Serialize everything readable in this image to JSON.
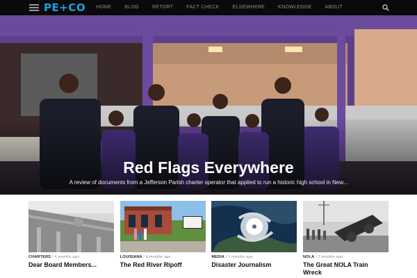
{
  "header": {
    "logo": "PE+CO",
    "nav": [
      "HOME",
      "BLOG",
      "RETORT",
      "FACT CHECK",
      "ELSEWHERE",
      "KNOWLEDGE",
      "ABOUT"
    ],
    "icons": {
      "menu": "hamburger-menu-icon",
      "search": "search-icon"
    },
    "colors": {
      "bar": "#0a0a0a",
      "logo": "#19a3e8"
    }
  },
  "hero": {
    "title": "Red Flags Everywhere",
    "subtitle": "A review of documents from a Jefferson Parish charter operator that applied to run a historic high school in New..."
  },
  "cards": [
    {
      "category": "CHARTERS",
      "age": "4 months ago",
      "title": "Dear Board Members..."
    },
    {
      "category": "LOUISIANA",
      "age": "6 months ago",
      "title": "The Red River Ripoff"
    },
    {
      "category": "MEDIA",
      "age": "7 months ago",
      "title": "Disaster Journalism"
    },
    {
      "category": "NOLA",
      "age": "7 months ago",
      "title": "The Great NOLA Train Wreck"
    }
  ]
}
